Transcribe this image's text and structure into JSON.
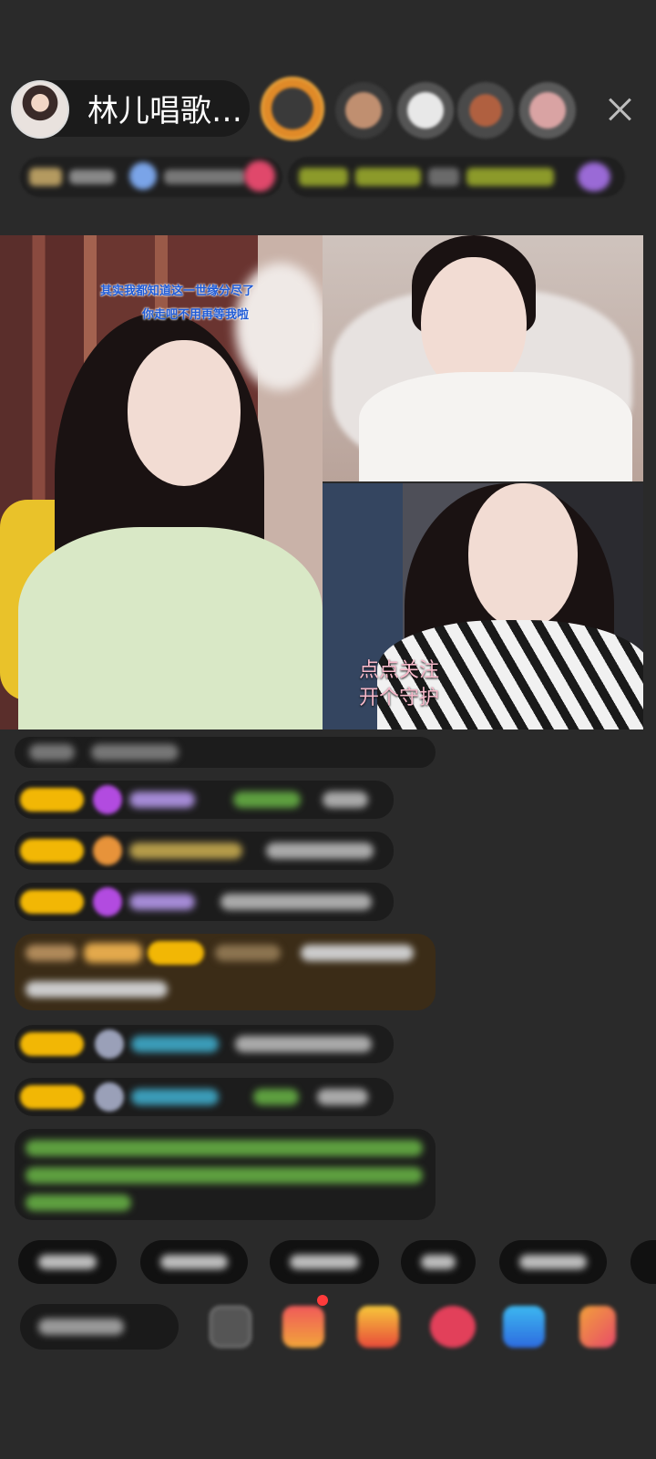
{
  "header": {
    "host_name": "林儿唱歌…"
  },
  "video": {
    "lyric_line1": "其实我都知道这一世缘分尽了",
    "lyric_line2": "你走吧不用再等我啦",
    "caption_line1": "点点关注",
    "caption_line2": "开个守护"
  },
  "colors": {
    "background": "#2a2a2a",
    "badge_gold": "#f2b705",
    "caption_pink": "#f6b8c9",
    "lyric_blue": "#1f5bd6"
  },
  "icons": {
    "close": "close-icon",
    "gift": "gift-icon"
  }
}
